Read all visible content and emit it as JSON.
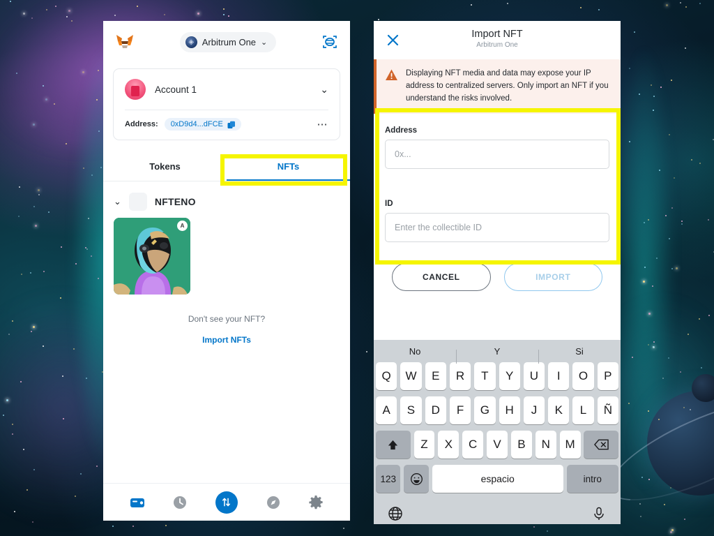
{
  "background": {
    "name": "space-nebula-wallpaper",
    "accent_teal": "#19bdb9",
    "deep": "#05141f"
  },
  "highlight_color": "#f5f500",
  "left_panel": {
    "app_icon": "metamask-fox-icon",
    "network": {
      "label": "Arbitrum One",
      "icon": "arbitrum-icon",
      "chevron": "⌄"
    },
    "scan_icon": "scan-qr-icon",
    "account": {
      "name": "Account 1",
      "avatar": "account-avatar",
      "chevron": "⌄",
      "address_label": "Address:",
      "address_value": "0xD9d4...dFCE",
      "copy_icon": "copy-icon",
      "more_icon": "⋯"
    },
    "tabs": [
      {
        "label": "Tokens",
        "active": false
      },
      {
        "label": "NFTs",
        "active": true
      }
    ],
    "collection": {
      "name": "NFTENO",
      "chevron": "⌄"
    },
    "nft_badge": "A",
    "empty_prompt": "Don't see your NFT?",
    "import_link": "Import NFTs",
    "bottom_nav": [
      {
        "name": "wallet-icon",
        "active": true
      },
      {
        "name": "history-clock-icon",
        "active": false
      },
      {
        "name": "swap-arrows-icon",
        "active": true
      },
      {
        "name": "explore-compass-icon",
        "active": false
      },
      {
        "name": "settings-gear-icon",
        "active": false
      }
    ]
  },
  "right_panel": {
    "close_icon": "close-x-icon",
    "title": "Import NFT",
    "subtitle": "Arbitrum One",
    "warning": {
      "icon": "warning-triangle-icon",
      "text": "Displaying NFT media and data may expose your IP address to centralized servers. Only import an NFT if you understand the risks involved.",
      "accent": "#d1642a",
      "background": "#fcf0ec"
    },
    "form": {
      "address_label": "Address",
      "address_value": "",
      "address_placeholder": "0x...",
      "id_label": "ID",
      "id_value": "",
      "id_placeholder": "Enter the collectible ID"
    },
    "buttons": {
      "cancel": "CANCEL",
      "import": "IMPORT"
    },
    "keyboard": {
      "suggestions": [
        "No",
        "Y",
        "Si"
      ],
      "row1": [
        "Q",
        "W",
        "E",
        "R",
        "T",
        "Y",
        "U",
        "I",
        "O",
        "P"
      ],
      "row2": [
        "A",
        "S",
        "D",
        "F",
        "G",
        "H",
        "J",
        "K",
        "L",
        "Ñ"
      ],
      "row3_letters": [
        "Z",
        "X",
        "C",
        "V",
        "B",
        "N",
        "M"
      ],
      "shift_key": "shift-icon",
      "backspace_key": "backspace-icon",
      "numeric_key": "123",
      "emoji_key": "emoji-icon",
      "space_key": "espacio",
      "enter_key": "intro",
      "globe_key": "globe-icon",
      "mic_key": "microphone-icon"
    }
  }
}
